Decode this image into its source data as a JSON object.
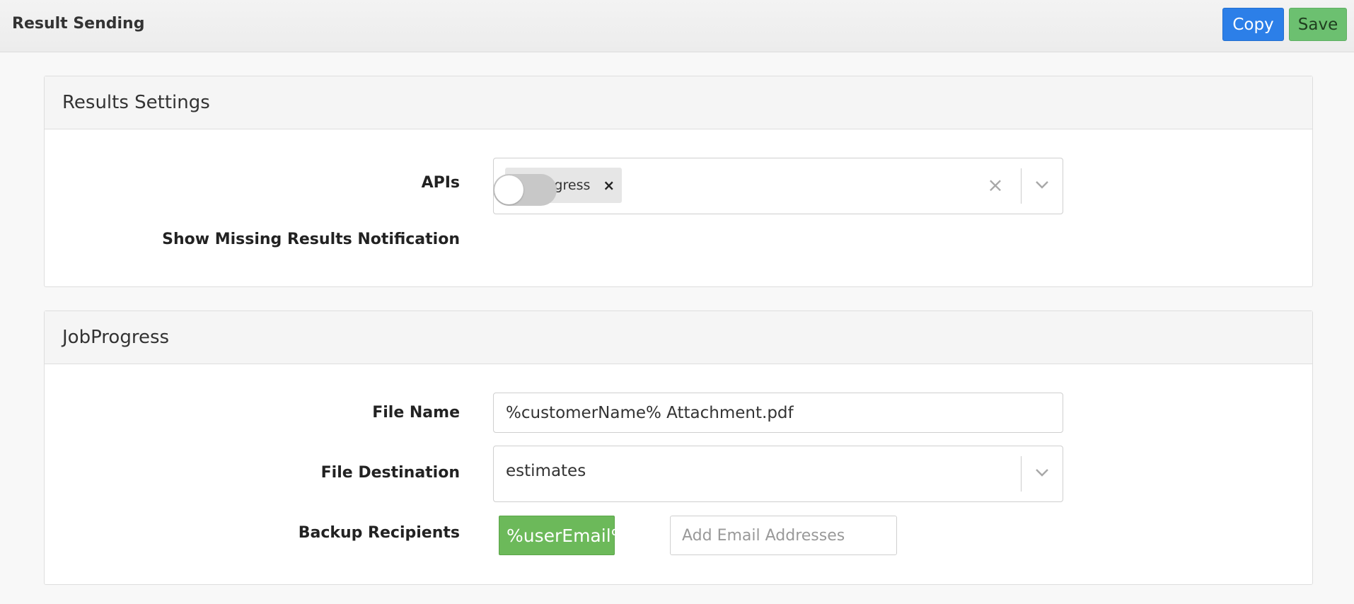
{
  "header": {
    "title": "Result Sending",
    "copy_label": "Copy",
    "save_label": "Save"
  },
  "results_settings": {
    "title": "Results Settings",
    "apis_label": "APIs",
    "apis_selected": [
      "JobProgress"
    ],
    "remove_glyph": "×",
    "clear_glyph": "×",
    "missing_notification_label": "Show Missing Results Notification",
    "missing_notification_enabled": false
  },
  "job_progress": {
    "title": "JobProgress",
    "file_name_label": "File Name",
    "file_name_value": "%customerName% Attachment.pdf",
    "file_destination_label": "File Destination",
    "file_destination_value": "estimates",
    "backup_recipients_label": "Backup Recipients",
    "backup_recipients": [
      "%userEmail%"
    ],
    "add_email_placeholder": "Add Email Addresses"
  },
  "colors": {
    "copy_button": "#2c7fe8",
    "save_button": "#6cc070",
    "email_chip": "#6cb95a",
    "toggle_off": "#c8c8c8"
  },
  "icons": {
    "dropdown": "chevron-down-icon",
    "clear": "clear-icon",
    "remove": "close-icon"
  }
}
